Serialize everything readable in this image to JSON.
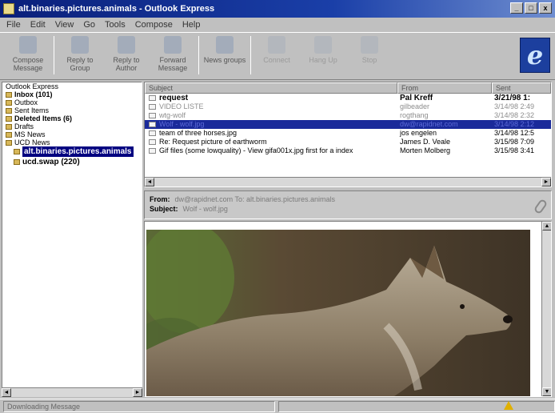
{
  "window": {
    "title": "alt.binaries.pictures.animals - Outlook Express",
    "buttons": [
      "_",
      "□",
      "x"
    ]
  },
  "menu": [
    "File",
    "Edit",
    "View",
    "Go",
    "Tools",
    "Compose",
    "Help"
  ],
  "toolbar": {
    "buttons": [
      {
        "label": "Compose Message",
        "enabled": true
      },
      {
        "label": "Reply to Group",
        "enabled": true
      },
      {
        "label": "Reply to Author",
        "enabled": true
      },
      {
        "label": "Forward Message",
        "enabled": true
      },
      {
        "label": "News groups",
        "enabled": true
      },
      {
        "label": "Connect",
        "enabled": false
      },
      {
        "label": "Hang Up",
        "enabled": false
      },
      {
        "label": "Stop",
        "enabled": false
      }
    ],
    "logo_letter": "e"
  },
  "folders": [
    {
      "label": "Outlook Express",
      "bold": false,
      "level": 0
    },
    {
      "label": "Inbox (101)",
      "bold": true,
      "level": 0
    },
    {
      "label": "Outbox",
      "bold": false,
      "level": 0
    },
    {
      "label": "Sent Items",
      "bold": false,
      "level": 0
    },
    {
      "label": "Deleted Items (6)",
      "bold": true,
      "level": 0
    },
    {
      "label": "Drafts",
      "bold": false,
      "level": 0
    },
    {
      "label": "MS News",
      "bold": false,
      "level": 0
    },
    {
      "label": "UCD News",
      "bold": false,
      "level": 0
    },
    {
      "label": "alt.binaries.pictures.animals",
      "bold": true,
      "level": 1,
      "selected": true
    },
    {
      "label": "ucd.swap (220)",
      "bold": true,
      "level": 1
    }
  ],
  "message_list": {
    "columns": [
      "Subject",
      "From",
      "Sent"
    ],
    "rows": [
      {
        "subject": "request",
        "from": "Pal Kreff",
        "sent": "3/21/98 1:",
        "style": "bold"
      },
      {
        "subject": "VIDEO LISTE",
        "from": "gilbeader",
        "sent": "3/14/98 2:49",
        "style": "faint"
      },
      {
        "subject": "wtg-wolf",
        "from": "rogthang",
        "sent": "3/14/98 2:32",
        "style": "faint"
      },
      {
        "subject": "Wolf - wolf.jpg",
        "from": "dw@rapidnet.com",
        "sent": "3/14/98 2:12",
        "style": "selected"
      },
      {
        "subject": "team of three horses.jpg",
        "from": "jos engelen",
        "sent": "3/14/98 12:5",
        "style": "normal"
      },
      {
        "subject": "Re: Request picture of earthworm",
        "from": "James D. Veale",
        "sent": "3/15/98 7:09",
        "style": "normal"
      },
      {
        "subject": "Gif files (some lowquality) - View gifa001x.jpg first for a index",
        "from": "Morten Molberg",
        "sent": "3/15/98 3:41",
        "style": "normal"
      }
    ]
  },
  "preview": {
    "from_label": "From:",
    "from_value": "dw@rapidnet.com   To: alt.binaries.pictures.animals",
    "subject_label": "Subject:",
    "subject_value": "Wolf - wolf.jpg"
  },
  "status": {
    "text": "Downloading Message"
  },
  "colors": {
    "title_bar": "#0a1f7a",
    "selection": "#1a2a9a",
    "chrome": "#c0c0c0"
  },
  "icons": {
    "logo": "internet-explorer-logo-icon",
    "attachment": "paperclip-icon",
    "warning": "warning-icon"
  }
}
